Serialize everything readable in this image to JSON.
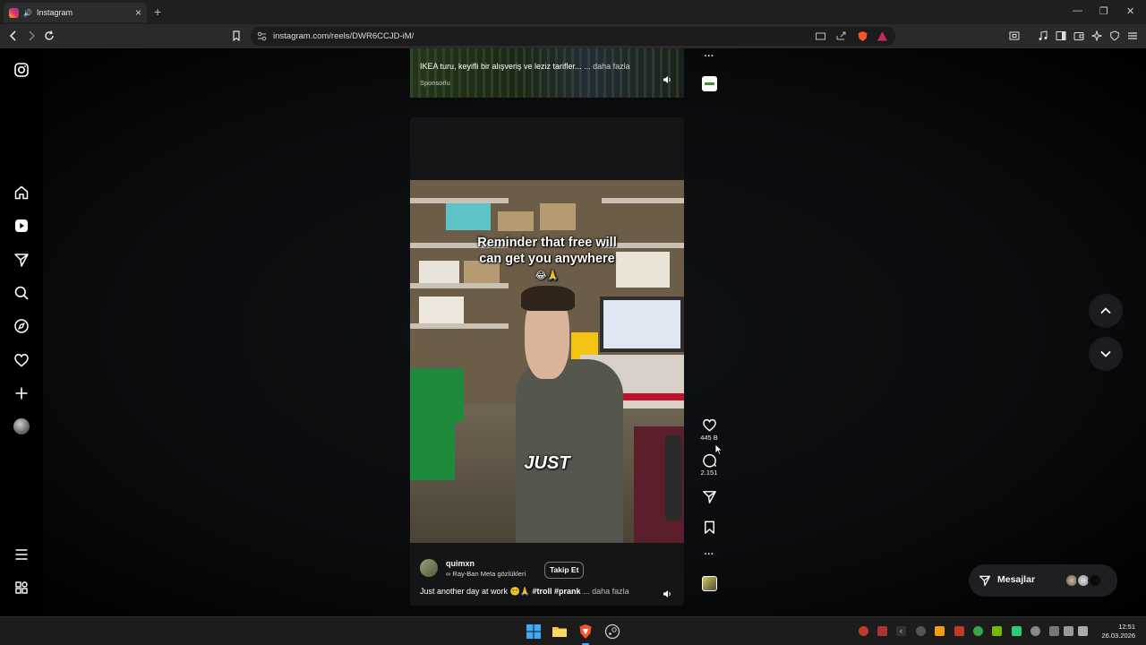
{
  "browser": {
    "tab_title": "Instagram",
    "new_tab": "+",
    "url": "instagram.com/reels/DWR6CCJD-iM/",
    "window_controls": [
      "—",
      "❐",
      "✕"
    ]
  },
  "sidebar": {
    "items": [
      {
        "name": "instagram-logo-icon"
      },
      {
        "name": "home-icon"
      },
      {
        "name": "reels-icon"
      },
      {
        "name": "direct-message-icon"
      },
      {
        "name": "search-icon"
      },
      {
        "name": "explore-icon"
      },
      {
        "name": "heart-icon"
      },
      {
        "name": "create-icon"
      },
      {
        "name": "profile-avatar"
      },
      {
        "name": "menu-icon"
      },
      {
        "name": "more-apps-icon"
      }
    ]
  },
  "ad_reel": {
    "caption": "IKEA turu, keyifli bir alışveriş ve leziz tarifler...",
    "more": "... daha fazla",
    "sponsored": "Sponsorlu"
  },
  "reel": {
    "overlay_text_line1": "Reminder that free will",
    "overlay_text_line2": "can get you anywhere",
    "overlay_emoji": "😂🙏",
    "subtitle_word": "JUST",
    "username": "quimxn",
    "audio": "∞ Ray-Ban Meta gözlükleri",
    "follow_label": "Takip Et",
    "caption_text": "Just another day at work",
    "caption_emojis": "😵‍💫🙏",
    "hashtags": "#troll #prank",
    "caption_more": "... daha fazla",
    "likes": "445 B",
    "comments": "2.151",
    "more_dots": "···"
  },
  "messages": {
    "label": "Mesajlar"
  },
  "taskbar": {
    "time": "12:51",
    "date": "26.03.2026"
  },
  "colors": {
    "background": "#000000",
    "accent_brave": "#fb542b",
    "instagram_gradient": [
      "#f7b900",
      "#e1306c",
      "#8a3ab9"
    ]
  }
}
